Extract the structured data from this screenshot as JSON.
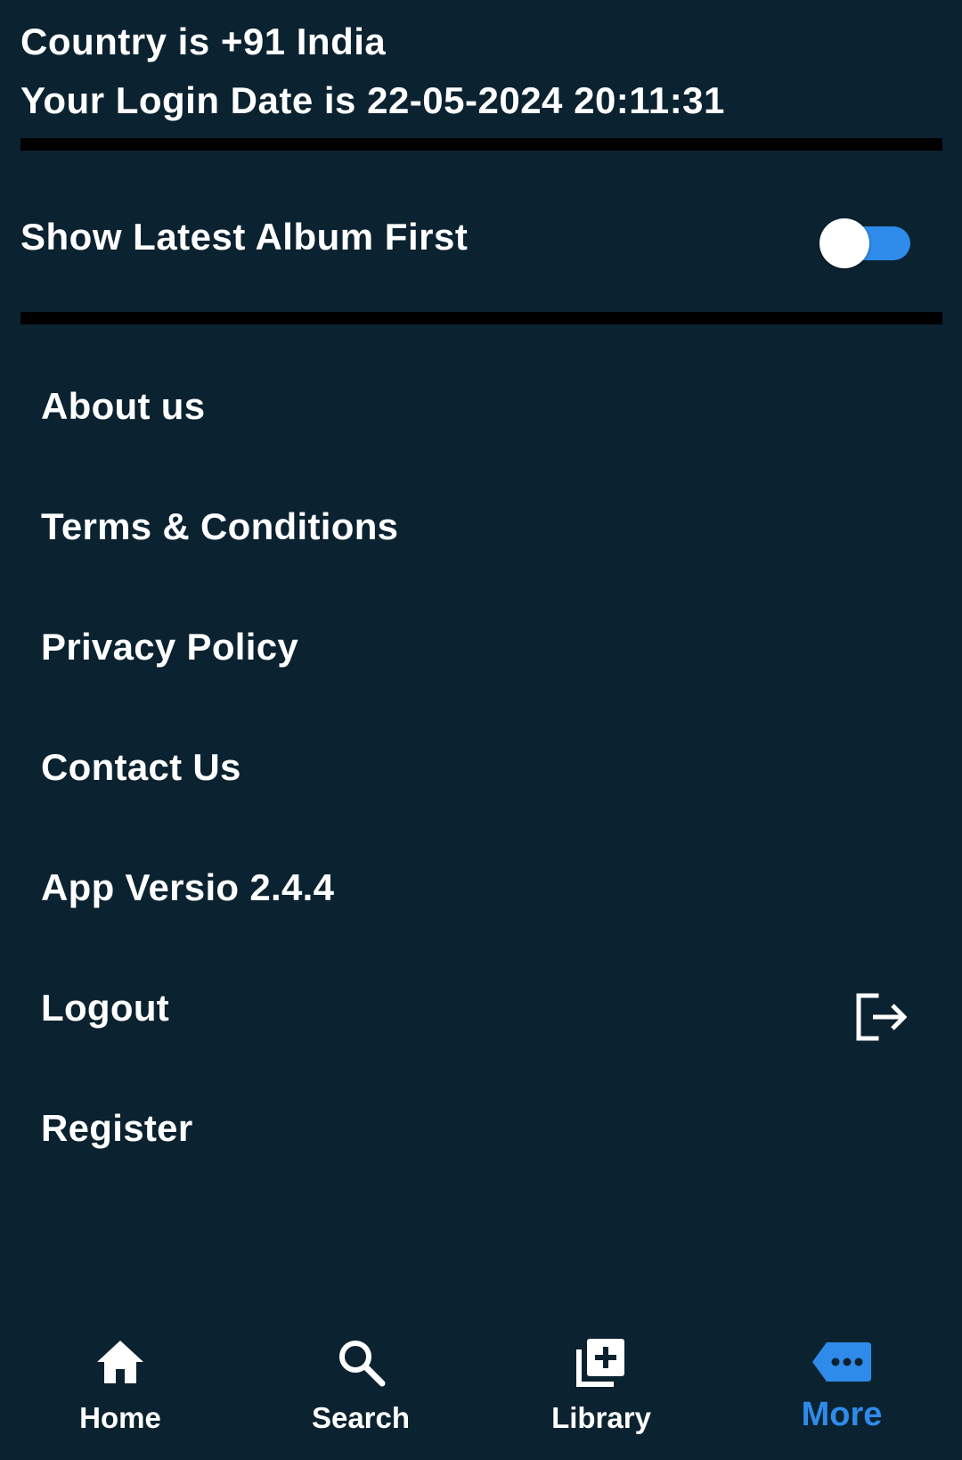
{
  "header": {
    "country_line": "Country is +91 India",
    "login_line": "Your Login Date is 22-05-2024 20:11:31"
  },
  "settings": {
    "latest_album_label": "Show Latest Album First",
    "latest_album_enabled": true
  },
  "menu": {
    "items": [
      {
        "label": "About us"
      },
      {
        "label": "Terms & Conditions"
      },
      {
        "label": "Privacy Policy"
      },
      {
        "label": "Contact Us"
      },
      {
        "label": "App Versio 2.4.4"
      },
      {
        "label": "Logout",
        "icon": "logout-icon"
      },
      {
        "label": "Register"
      }
    ]
  },
  "bottom_nav": {
    "items": [
      {
        "label": "Home",
        "icon": "home-icon"
      },
      {
        "label": "Search",
        "icon": "search-icon"
      },
      {
        "label": "Library",
        "icon": "library-add-icon"
      },
      {
        "label": "More",
        "icon": "more-icon",
        "active": true
      }
    ]
  },
  "colors": {
    "background": "#0b2230",
    "accent": "#2f8bea",
    "divider": "#000000",
    "text": "#ffffff"
  }
}
